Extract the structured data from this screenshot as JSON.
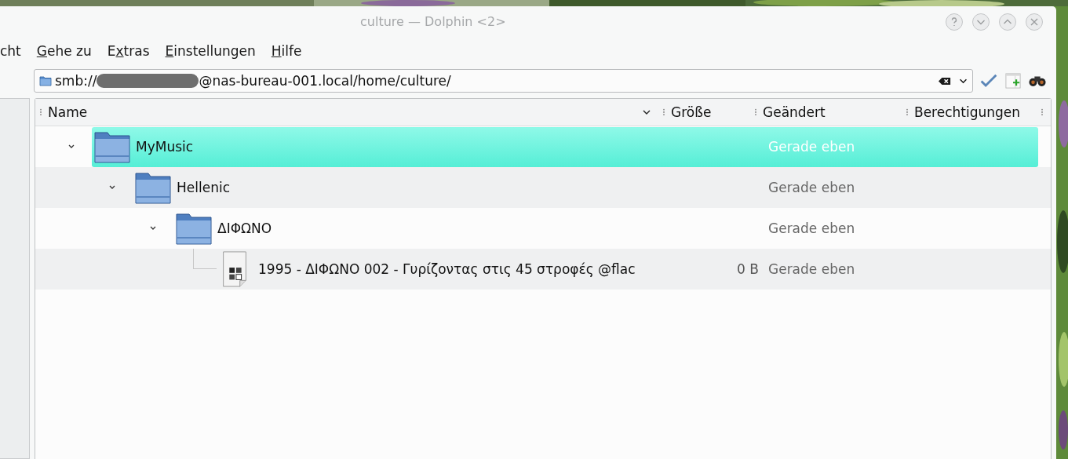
{
  "window": {
    "title": "culture — Dolphin <2>"
  },
  "menu": [
    {
      "before": "cht"
    },
    {
      "accel": "G",
      "after": "ehe zu"
    },
    {
      "before": "E",
      "accel": "x",
      "after": "tras"
    },
    {
      "accel": "E",
      "after": "instellungen"
    },
    {
      "accel": "H",
      "after": "ilfe"
    }
  ],
  "location": {
    "prefix": "smb://",
    "redacted": true,
    "suffix": "@nas-bureau-001.local/home/culture/"
  },
  "columns": [
    {
      "label": "Name",
      "sorted": true
    },
    {
      "label": "Größe",
      "sorted": false
    },
    {
      "label": "Geändert",
      "sorted": false
    },
    {
      "label": "Berechtigungen",
      "sorted": false
    }
  ],
  "tree": [
    {
      "kind": "folder",
      "name": "MyMusic",
      "modified": "Gerade eben",
      "selected": true,
      "expanded": true,
      "children": [
        {
          "kind": "folder",
          "name": "Hellenic",
          "modified": "Gerade eben",
          "selected": false,
          "expanded": true,
          "children": [
            {
              "kind": "folder",
              "name": "ΔΙΦΩΝΟ",
              "modified": "Gerade eben",
              "selected": false,
              "expanded": true,
              "children": [
                {
                  "kind": "file",
                  "name": "1995 - ΔΙΦΩΝΟ 002 - Γυρίζοντας στις 45 στροφές @flac",
                  "size": "0 B",
                  "modified": "Gerade eben",
                  "selected": false
                }
              ]
            }
          ]
        }
      ]
    }
  ]
}
